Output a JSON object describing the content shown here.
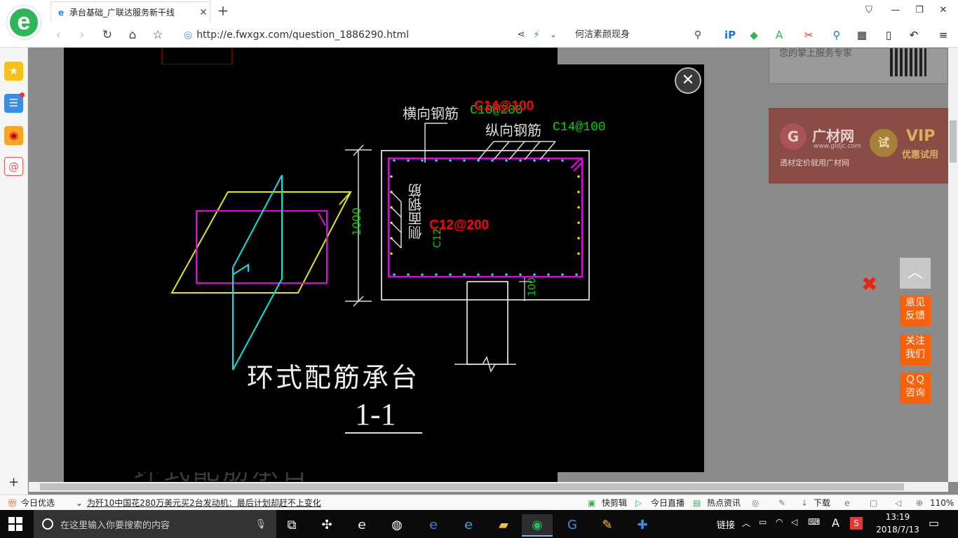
{
  "browser": {
    "tab_title": "承台基础_广联达服务新干线",
    "url": "http://e.fwxgx.com/question_1886290.html",
    "search_text": "何洁素颜现身"
  },
  "page": {
    "ad_text_top": "您的掌上服务专家",
    "ad_brand": "广材网",
    "ad_domain": "www.gldjc.com",
    "ad_slogan": "透材定价就用广材网",
    "ad_trial": "试",
    "ad_vip": "VIP",
    "ad_vip_sub": "优惠试用",
    "behind_text": "环式配筋承台"
  },
  "drawing": {
    "label_transverse": "横向钢筋",
    "label_transverse_spec": "C10@200",
    "label_transverse_red": "C14@100",
    "label_longitudinal": "纵向钢筋",
    "label_longitudinal_spec": "C14@100",
    "label_side": "侧面钢筋",
    "label_side_spec": "C12",
    "label_side_red": "C12@200",
    "dim_height": "1000",
    "dim_bottom": "100",
    "title": "环式配筋承台",
    "section": "1-1"
  },
  "right_float": {
    "feedback": [
      "意见",
      "反馈"
    ],
    "follow": [
      "关注",
      "我们"
    ],
    "qq": [
      "ＱＱ",
      "咨询"
    ]
  },
  "statusbar": {
    "today": "今日优选",
    "news": "为歼10中国花280万美元买2台发动机：最后计划却赶不上变化",
    "clip": "快剪辑",
    "live": "今日直播",
    "hot": "热点资讯",
    "download": "下载",
    "zoom": "110%"
  },
  "taskbar": {
    "search_placeholder": "在这里输入你要搜索的内容",
    "link_label": "链接",
    "ime": "A",
    "time": "13:19",
    "date": "2018/7/13"
  },
  "colors": {
    "cad_yellow": "#e6e600",
    "cad_cyan": "#00e5e5",
    "cad_magenta": "#e600e6",
    "cad_green": "#00d000",
    "float_orange": "#f7620d"
  }
}
